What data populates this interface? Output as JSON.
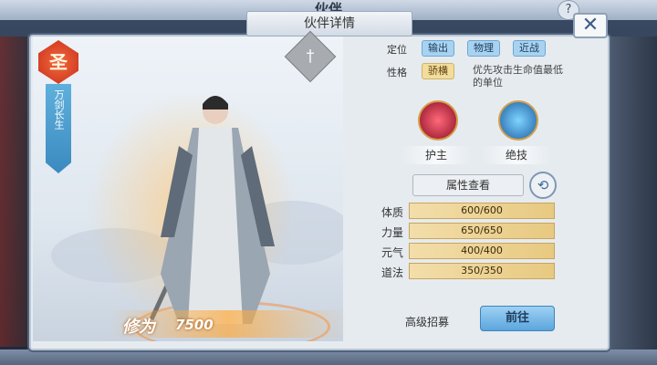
{
  "window": {
    "title": "伙伴",
    "help": "?"
  },
  "panel": {
    "title": "伙伴详情",
    "close": "✕"
  },
  "companion": {
    "rank_badge": "圣",
    "name": "万剑长生",
    "xiuwei_label": "修为",
    "xiuwei_value": "7500"
  },
  "info": {
    "position_label": "定位",
    "position_tags": [
      "输出",
      "物理",
      "近战"
    ],
    "personality_label": "性格",
    "personality_tag": "骄横",
    "personality_desc": "优先攻击生命值最低的单位",
    "skills": [
      {
        "label": "护主",
        "icon": "red-crystal-skill-icon"
      },
      {
        "label": "绝技",
        "icon": "blue-dragon-skill-icon"
      }
    ],
    "attr_button": "属性查看",
    "stats": [
      {
        "label": "体质",
        "value": "600/600"
      },
      {
        "label": "力量",
        "value": "650/650"
      },
      {
        "label": "元气",
        "value": "400/400"
      },
      {
        "label": "道法",
        "value": "350/350"
      }
    ],
    "recruit_label": "高级招募",
    "goto_button": "前往"
  },
  "colors": {
    "accent": "#5ba6dd",
    "stat_bar": "#e7c980",
    "badge": "#c72c1c"
  }
}
